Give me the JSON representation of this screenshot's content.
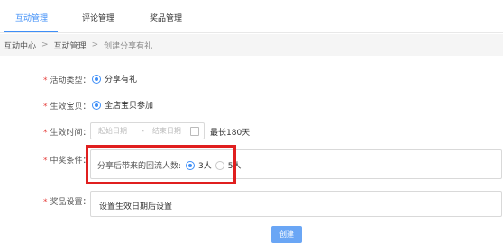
{
  "tabs": [
    {
      "label": "互动管理",
      "active": true
    },
    {
      "label": "评论管理",
      "active": false
    },
    {
      "label": "奖品管理",
      "active": false
    }
  ],
  "breadcrumb": {
    "items": [
      "互动中心",
      "互动管理",
      "创建分享有礼"
    ],
    "separator": ">"
  },
  "form": {
    "required_mark": "*",
    "activity_type": {
      "label": "活动类型：",
      "option": "分享有礼",
      "selected": true
    },
    "effective_item": {
      "label": "生效宝贝：",
      "option": "全店宝贝参加",
      "selected": true
    },
    "effective_time": {
      "label": "生效时间：",
      "start_placeholder": "起始日期",
      "separator": "-",
      "end_placeholder": "结束日期",
      "note": "最长180天"
    },
    "win_condition": {
      "label": "中奖条件：",
      "field_label": "分享后带来的回流人数:",
      "options": [
        {
          "label": "3人",
          "selected": true
        },
        {
          "label": "5人",
          "selected": false
        }
      ]
    },
    "prize": {
      "label": "奖品设置：",
      "value": "设置生效日期后设置"
    },
    "submit_label": "创建"
  },
  "colors": {
    "accent": "#3e8ef7",
    "required": "#e64340",
    "highlight": "#e01f1f",
    "button": "#6aa6f5"
  }
}
